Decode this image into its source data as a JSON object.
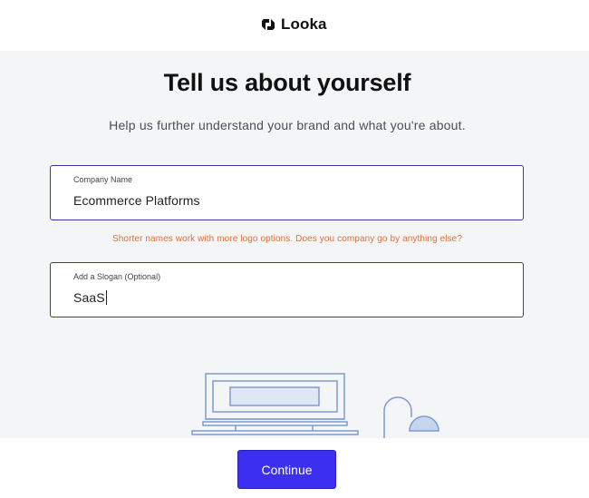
{
  "brand": {
    "name": "Looka",
    "logo_icon": "looka-logo-icon"
  },
  "page": {
    "title": "Tell us about yourself",
    "subtitle": "Help us further understand your brand and what you're about."
  },
  "form": {
    "company": {
      "label": "Company Name",
      "value": "Ecommerce Platforms"
    },
    "hint": "Shorter names work with more logo options. Does you company go by anything else?",
    "slogan": {
      "label": "Add a Slogan (Optional)",
      "value": "SaaS"
    }
  },
  "footer": {
    "continue_label": "Continue"
  },
  "colors": {
    "accent": "#3d2ff0",
    "field_border": "#3b37a6",
    "hint": "#e2703a",
    "background": "#f4f5f7",
    "illustration_stroke": "#7d9bd1"
  }
}
